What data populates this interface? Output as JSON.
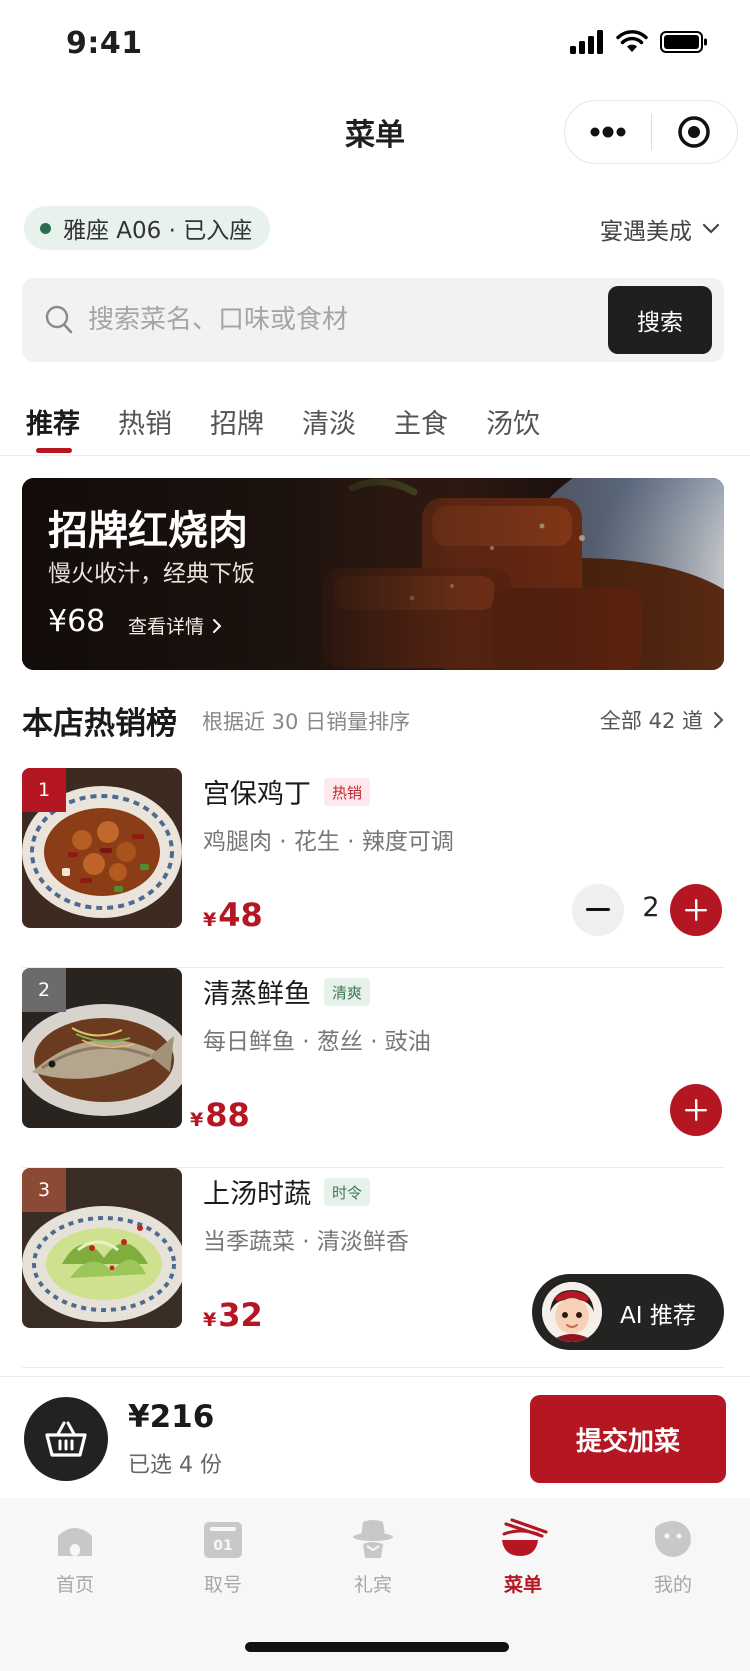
{
  "status_bar": {
    "time": "9:41"
  },
  "nav": {
    "title": "菜单"
  },
  "table": {
    "label": "雅座 A06 · 已入座",
    "store": "宴遇美成"
  },
  "search": {
    "placeholder": "搜索菜名、口味或食材",
    "button": "搜索"
  },
  "tabs": [
    {
      "label": "推荐",
      "active": true
    },
    {
      "label": "热销"
    },
    {
      "label": "招牌"
    },
    {
      "label": "清淡"
    },
    {
      "label": "主食"
    },
    {
      "label": "汤饮"
    }
  ],
  "banner": {
    "title": "招牌红烧肉",
    "subtitle": "慢火收汁，经典下饭",
    "price": "¥68",
    "link": "查看详情"
  },
  "hot_list": {
    "title": "本店热销榜",
    "subtitle": "根据近 30 日销量排序",
    "all": "全部 42 道"
  },
  "dishes": [
    {
      "rank": "1",
      "name": "宫保鸡丁",
      "tag": "热销",
      "desc": "鸡腿肉 · 花生 · 辣度可调",
      "currency": "¥",
      "price": "48",
      "qty": "2"
    },
    {
      "rank": "2",
      "name": "清蒸鲜鱼",
      "tag": "清爽",
      "desc": "每日鲜鱼 · 葱丝 · 豉油",
      "currency": "¥",
      "price": "88"
    },
    {
      "rank": "3",
      "name": "上汤时蔬",
      "tag": "时令",
      "desc": "当季蔬菜 · 清淡鲜香",
      "currency": "¥",
      "price": "32"
    }
  ],
  "ai": {
    "label": "AI 推荐"
  },
  "cart": {
    "total": "¥216",
    "count": "已选 4 份",
    "submit": "提交加菜"
  },
  "tabbar": [
    {
      "label": "首页",
      "icon": "home-icon"
    },
    {
      "label": "取号",
      "icon": "queue-ticket-icon"
    },
    {
      "label": "礼宾",
      "icon": "concierge-icon"
    },
    {
      "label": "菜单",
      "icon": "menu-bowl-icon",
      "active": true
    },
    {
      "label": "我的",
      "icon": "profile-icon"
    }
  ],
  "colors": {
    "brand": "#b41622",
    "dark": "#1f1f1d",
    "seated_dot": "#2e6b4f"
  }
}
